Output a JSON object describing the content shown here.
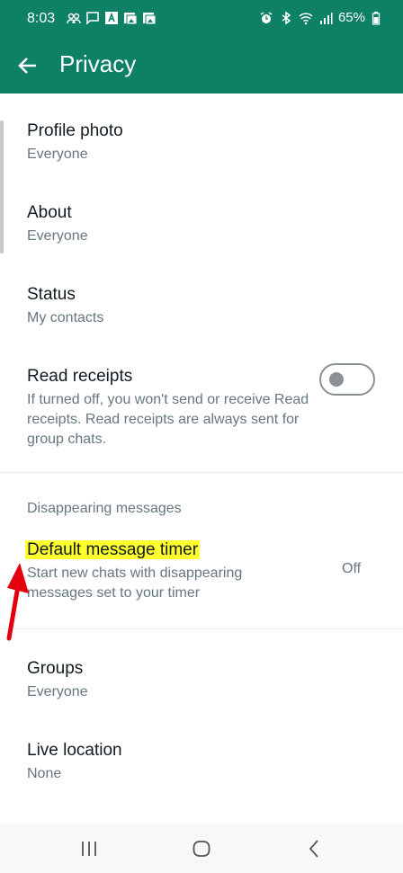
{
  "status_bar": {
    "time": "8:03",
    "battery": "65%",
    "left_icons": [
      "people-icon",
      "chat-icon",
      "a-icon",
      "image-icon",
      "image-icon"
    ],
    "right_icons": [
      "alarm-icon",
      "bluetooth-icon",
      "wifi-icon",
      "signal-icon",
      "battery-icon"
    ]
  },
  "app_bar": {
    "title": "Privacy",
    "back_icon": "arrow-left-icon"
  },
  "items": {
    "profile_photo": {
      "title": "Profile photo",
      "value": "Everyone"
    },
    "about": {
      "title": "About",
      "value": "Everyone"
    },
    "status": {
      "title": "Status",
      "value": "My contacts"
    },
    "read_receipts": {
      "title": "Read receipts",
      "description": "If turned off, you won't send or receive Read receipts. Read receipts are always sent for group chats.",
      "enabled": false
    },
    "groups": {
      "title": "Groups",
      "value": "Everyone"
    },
    "live_location": {
      "title": "Live location",
      "value": "None"
    }
  },
  "disappearing": {
    "section_title": "Disappearing messages",
    "timer_title": "Default message timer",
    "timer_description": "Start new chats with disappearing messages set to your timer",
    "timer_value": "Off"
  },
  "colors": {
    "header": "#0d8066",
    "highlight": "#ffff2e",
    "annotation_arrow": "#e3000f"
  },
  "nav_bar": {
    "icons": [
      "recent-apps-icon",
      "home-icon",
      "back-nav-icon"
    ]
  }
}
